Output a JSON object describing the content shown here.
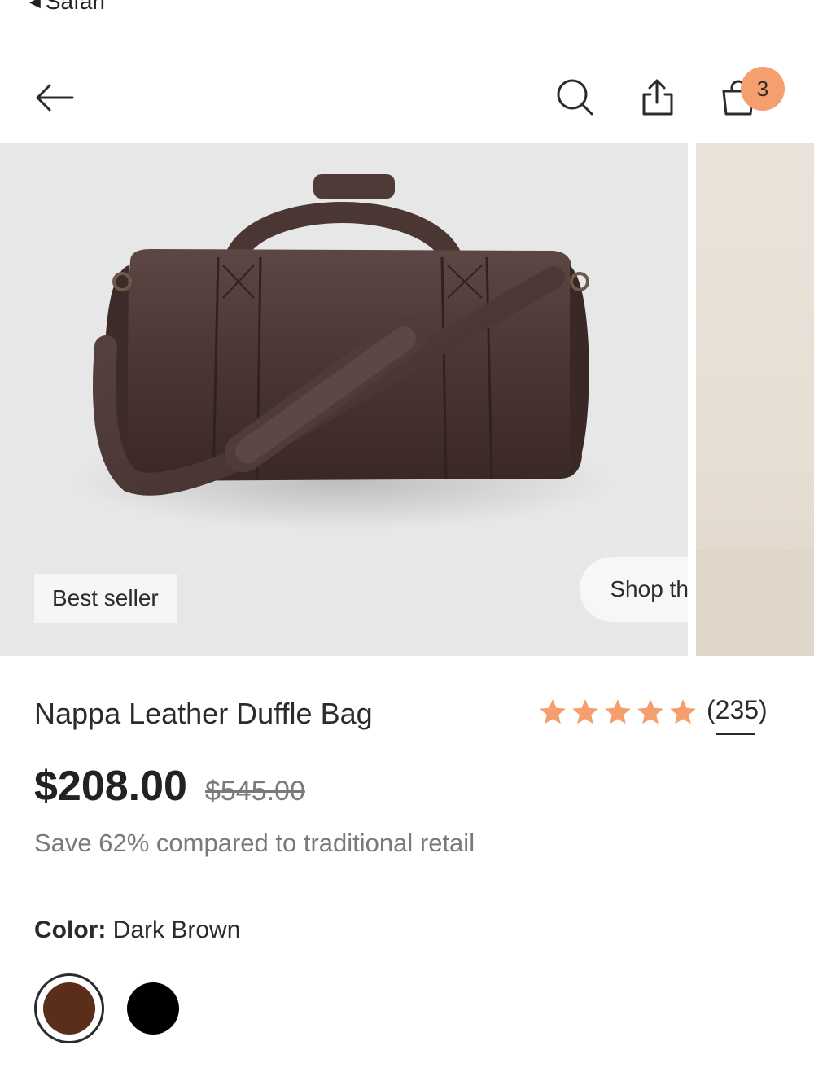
{
  "status": {
    "back_label": "Safari"
  },
  "header": {
    "cart_count": "3"
  },
  "gallery": {
    "badge": "Best seller",
    "shop_look": "Shop the look"
  },
  "product": {
    "title": "Nappa Leather Duffle Bag",
    "rating_stars": 5,
    "review_count": "(235)",
    "price": "$208.00",
    "original_price": "$545.00",
    "savings_text": "Save 62% compared to traditional retail",
    "color_label": "Color:",
    "color_value": "Dark Brown",
    "colors": [
      {
        "name": "Dark Brown",
        "hex": "#5a2e1a",
        "selected": true
      },
      {
        "name": "Black",
        "hex": "#000000",
        "selected": false
      }
    ]
  },
  "theme": {
    "accent": "#f59f6e"
  }
}
